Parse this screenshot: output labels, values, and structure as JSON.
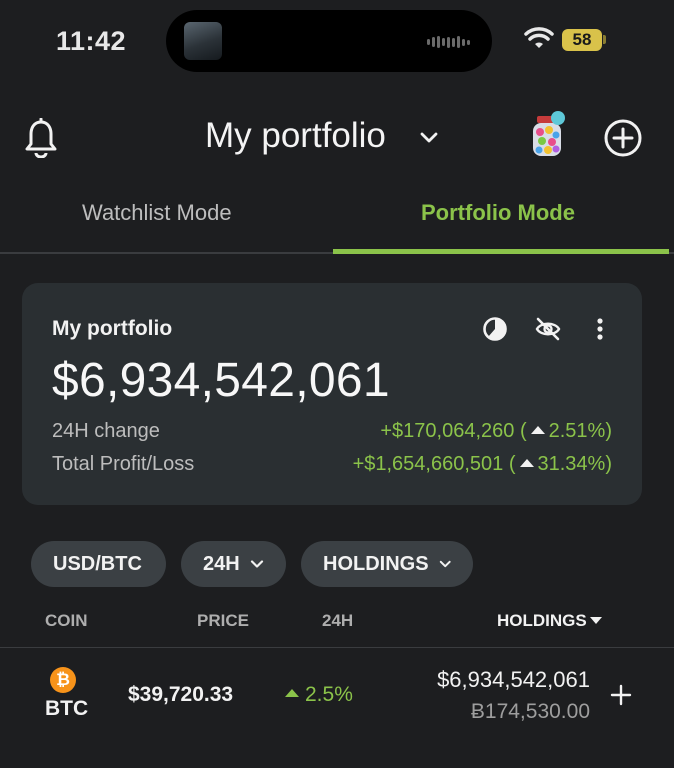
{
  "status_bar": {
    "time": "11:42",
    "battery": "58"
  },
  "header": {
    "title": "My portfolio"
  },
  "tabs": [
    {
      "label": "Watchlist Mode",
      "active": false
    },
    {
      "label": "Portfolio Mode",
      "active": true
    }
  ],
  "card": {
    "title": "My portfolio",
    "total": "$6,934,542,061",
    "change_label": "24H change",
    "change_value": "+$170,064,260 (",
    "change_pct": "2.51%)",
    "pl_label": "Total Profit/Loss",
    "pl_value": "+$1,654,660,501 (",
    "pl_pct": "31.34%)"
  },
  "filters": {
    "currency": "USD/BTC",
    "period": "24H",
    "sort": "HOLDINGS"
  },
  "columns": {
    "coin": "COIN",
    "price": "PRICE",
    "change": "24H",
    "holdings": "HOLDINGS"
  },
  "rows": [
    {
      "icon": "bitcoin-icon",
      "icon_glyph": "₿",
      "symbol": "BTC",
      "price": "$39,720.33",
      "change": "2.5%",
      "holdings_value": "$6,934,542,061",
      "holdings_coin": "Ƀ174,530.00"
    }
  ],
  "colors": {
    "accent_green": "#8bc34a",
    "background": "#1d1e20",
    "card": "#2a2f32",
    "bitcoin_orange": "#f7931a"
  }
}
